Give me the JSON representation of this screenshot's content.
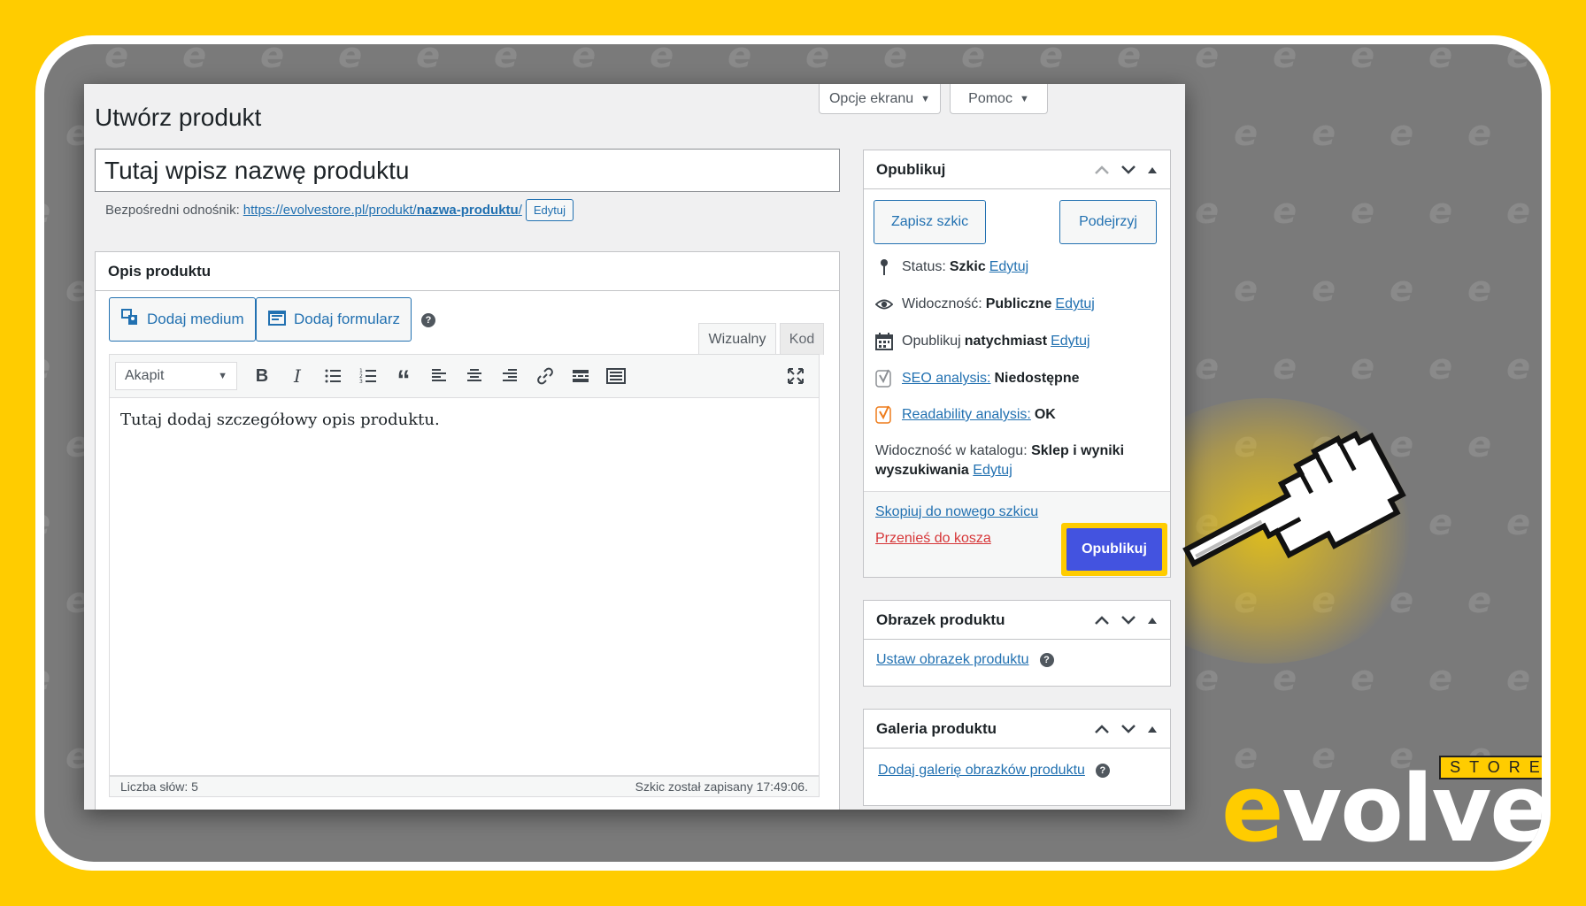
{
  "page": {
    "title": "Utwórz produkt"
  },
  "screen_options": {
    "label": "Opcje ekranu",
    "arrow": "▼"
  },
  "help_tab": {
    "label": "Pomoc",
    "arrow": "▼"
  },
  "product_title": {
    "placeholder": "Tutaj wpisz nazwę produktu"
  },
  "permalink": {
    "label": "Bezpośredni odnośnik:",
    "base": "https://evolvestore.pl/produkt/",
    "slug": "nazwa-produktu",
    "trailing": "/",
    "edit_label": "Edytuj"
  },
  "description_box": {
    "title": "Opis produktu",
    "add_media_label": "Dodaj medium",
    "add_form_label": "Dodaj formularz",
    "help": "?",
    "tab_visual": "Wizualny",
    "tab_code": "Kod",
    "format_select": "Akapit",
    "content": "Tutaj dodaj szczegółowy opis produktu.",
    "word_count": "Liczba słów: 5",
    "saved_status": "Szkic został zapisany 17:49:06."
  },
  "publish_box": {
    "title": "Opublikuj",
    "save_draft_label": "Zapisz szkic",
    "preview_label": "Podejrzyj",
    "status_label": "Status:",
    "status_value": "Szkic",
    "visibility_label": "Widoczność:",
    "visibility_value": "Publiczne",
    "publish_label": "Opublikuj",
    "publish_value": "natychmiast",
    "edit_link": "Edytuj",
    "seo_label": "SEO analysis:",
    "seo_value": "Niedostępne",
    "readability_label": "Readability analysis:",
    "readability_value": "OK",
    "catalog_label": "Widoczność w katalogu:",
    "catalog_value": "Sklep i wyniki wyszukiwania",
    "copy_draft_label": "Skopiuj do nowego szkicu",
    "trash_label": "Przenieś do kosza",
    "publish_button_label": "Opublikuj"
  },
  "image_box": {
    "title": "Obrazek produktu",
    "set_image_label": "Ustaw obrazek produktu",
    "help": "?"
  },
  "gallery_box": {
    "title": "Galeria produktu",
    "add_gallery_label": "Dodaj galerię obrazków produktu",
    "help": "?"
  },
  "brand": {
    "letter_e": "e",
    "rest": "volve",
    "store": "STORE",
    "pattern_glyph": "e"
  },
  "colors": {
    "background": "#ffcc00",
    "frame_gray": "#7a7a7a",
    "wp_link": "#2271b1",
    "publish_button": "#4353e0",
    "trash_red": "#d63638",
    "yoast_gray": "#8c8f94",
    "yoast_orange": "#ee7c1b"
  }
}
